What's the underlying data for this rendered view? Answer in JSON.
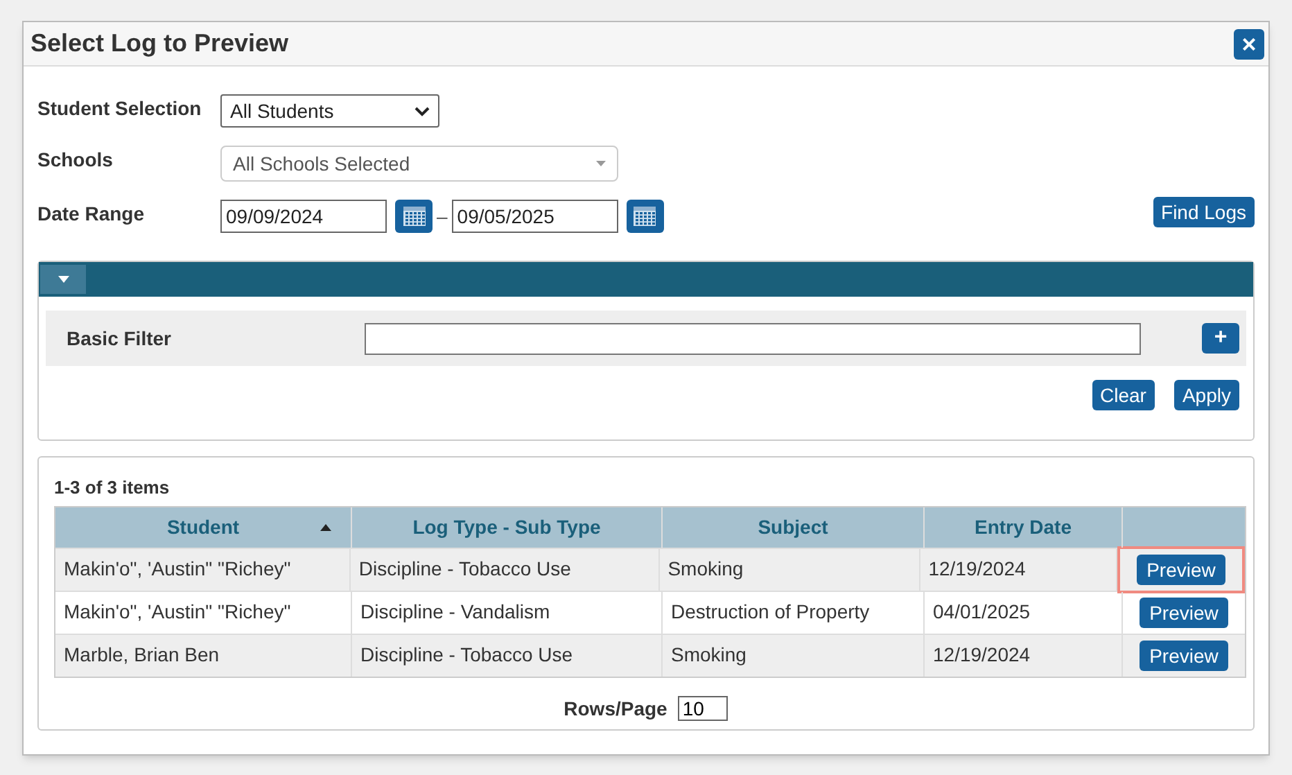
{
  "dialog": {
    "title": "Select Log to Preview",
    "close_label": "×"
  },
  "criteria": {
    "student_selection": {
      "label": "Student Selection",
      "value": "All Students"
    },
    "schools": {
      "label": "Schools",
      "value": "All Schools Selected"
    },
    "date_range": {
      "label": "Date Range",
      "from": "09/09/2024",
      "separator": "–",
      "to": "09/05/2025"
    },
    "find_button": "Find Logs"
  },
  "filter": {
    "expanded": true,
    "label": "Basic Filter",
    "add_label": "+",
    "buttons": [
      "Clear",
      "Apply"
    ]
  },
  "table": {
    "count": "1-3 of 3 items",
    "columns": [
      {
        "label": "Student",
        "sorted": true
      },
      {
        "label": "Log Type - Sub Type",
        "sorted": false
      },
      {
        "label": "Subject",
        "sorted": false
      },
      {
        "label": "Entry Date",
        "sorted": false
      }
    ],
    "rows": [
      {
        "student": "Makin'o\", 'Austin\" \"Richey\"",
        "log_type": "Discipline - Tobacco Use",
        "subject": "Smoking",
        "entry_date": "12/19/2024",
        "action": "Preview",
        "highlighted": true
      },
      {
        "student": "Makin'o\", 'Austin\" \"Richey\"",
        "log_type": "Discipline - Vandalism",
        "subject": "Destruction of Property",
        "entry_date": "04/01/2025",
        "action": "Preview",
        "highlighted": false
      },
      {
        "student": "Marble, Brian Ben",
        "log_type": "Discipline - Tobacco Use",
        "subject": "Smoking",
        "entry_date": "12/19/2024",
        "action": "Preview",
        "highlighted": false
      }
    ],
    "rows_per_page": {
      "label": "Rows/Page",
      "value": "10"
    }
  }
}
